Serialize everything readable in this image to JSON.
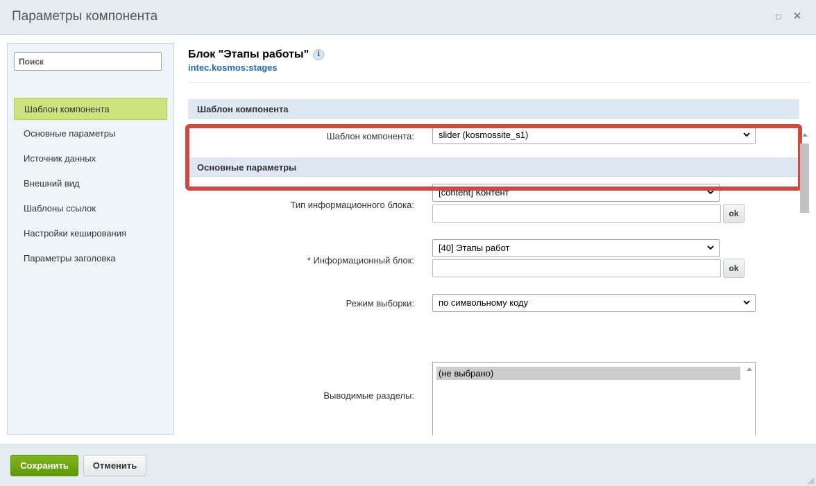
{
  "window": {
    "title": "Параметры компонента",
    "maximize_icon": "□",
    "close_icon": "✕"
  },
  "sidebar": {
    "search_placeholder": "Поиск",
    "items": [
      {
        "label": "Шаблон компонента",
        "active": true
      },
      {
        "label": "Основные параметры",
        "active": false
      },
      {
        "label": "Источник данных",
        "active": false
      },
      {
        "label": "Внешний вид",
        "active": false
      },
      {
        "label": "Шаблоны ссылок",
        "active": false
      },
      {
        "label": "Настройки кеширования",
        "active": false
      },
      {
        "label": "Параметры заголовка",
        "active": false
      }
    ]
  },
  "component": {
    "title": "Блок \"Этапы работы\"",
    "info_icon": "i",
    "code": "intec.kosmos:stages"
  },
  "sections": {
    "template": {
      "heading": "Шаблон компонента",
      "label": "Шаблон компонента:",
      "value": "slider (kosmossite_s1)"
    },
    "basic": {
      "heading": "Основные параметры",
      "iblock_type": {
        "label": "Тип информационного блока:",
        "value": "[content] Контент",
        "input_value": "",
        "ok_label": "ok"
      },
      "iblock": {
        "label": "* Информационный блок:",
        "value": "[40] Этапы работ",
        "input_value": "",
        "ok_label": "ok"
      },
      "mode": {
        "label": "Режим выборки:",
        "value": "по символьному коду"
      },
      "sections": {
        "label": "Выводимые разделы:",
        "options": [
          "(не выбрано)"
        ]
      }
    }
  },
  "footer": {
    "save_label": "Сохранить",
    "cancel_label": "Отменить"
  },
  "colors": {
    "highlight_border": "#cd4a3f",
    "active_nav": "#cde37d",
    "save_button": "#6aa40f",
    "section_header": "#dde8f3"
  }
}
